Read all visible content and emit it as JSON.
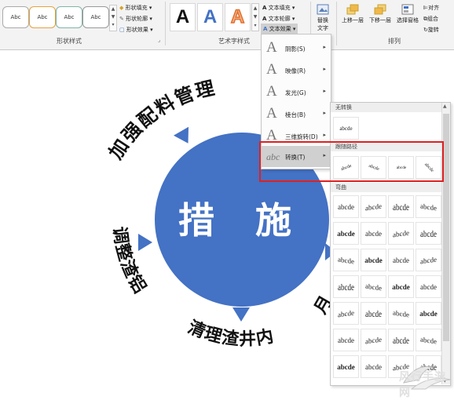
{
  "ribbon": {
    "shape_styles": {
      "boxes": [
        "Abc",
        "Abc",
        "Abc",
        "Abc"
      ],
      "fill": "形状填充",
      "outline": "形状轮廓",
      "effects": "形状效果",
      "group_label": "形状样式"
    },
    "wordart": {
      "samples": [
        "A",
        "A",
        "A"
      ],
      "fill": "文本填充",
      "outline": "文本轮廓",
      "effects": "文本效果",
      "group_label": "艺术字样式"
    },
    "alt_text": {
      "line1": "替换",
      "line2": "文字"
    },
    "arrange": {
      "forward": "上移一层",
      "backward": "下移一层",
      "select_pane": "选择窗格",
      "align": "对齐",
      "group": "组合",
      "rotate": "旋转",
      "group_label": "排列"
    }
  },
  "slide": {
    "center": "措 施",
    "top_arc": "加强配料管理",
    "left_arc": "调整渣铝",
    "bottom_arc": "清理渣井内渣",
    "right_partial": "月"
  },
  "effects_menu": {
    "items": [
      {
        "icon": "A",
        "label": "阴影(S)"
      },
      {
        "icon": "A",
        "label": "映像(R)"
      },
      {
        "icon": "A",
        "label": "发光(G)"
      },
      {
        "icon": "A",
        "label": "棱台(B)"
      },
      {
        "icon": "A",
        "label": "三维旋转(D)"
      },
      {
        "icon": "abc",
        "label": "转换(T)"
      }
    ]
  },
  "transform_gallery": {
    "no_transform_title": "无转换",
    "no_transform_sample": "abcde",
    "follow_path_title": "跟随路径",
    "follow_path": [
      "abcde",
      "abcde",
      "abcde",
      "abcde"
    ],
    "warp_title": "弯曲",
    "warp": [
      [
        "abcde",
        "abcde",
        "abcde",
        "abcde"
      ],
      [
        "abcde",
        "abcde",
        "abcde",
        "abcde"
      ],
      [
        "abcde",
        "abcde",
        "abcde",
        "abcde"
      ],
      [
        "abcde",
        "abcde",
        "abcde",
        "abcde"
      ],
      [
        "abcde",
        "abcde",
        "abcde",
        "abcde"
      ],
      [
        "abcde",
        "abcde",
        "abcde",
        "abcde"
      ],
      [
        "abcde",
        "abcde",
        "abcde",
        "abcde"
      ]
    ]
  },
  "watermark": "风行手游网",
  "colors": {
    "accent": "#4472c4",
    "highlight_box": "#e02020"
  }
}
